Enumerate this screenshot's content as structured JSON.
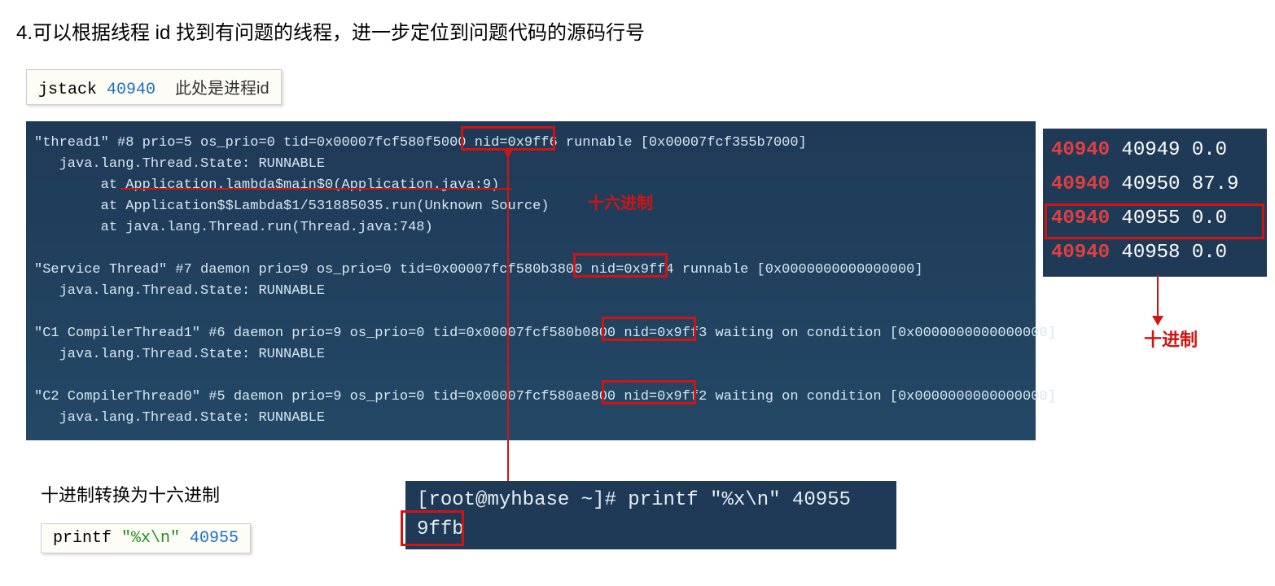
{
  "heading": "4.可以根据线程 id 找到有问题的线程，进一步定位到问题代码的源码行号",
  "box1_cmd": "jstack ",
  "box1_pid": "40940",
  "box1_note": "此处是进程id",
  "term_lines": [
    "\"thread1\" #8 prio=5 os_prio=0 tid=0x00007fcf580f5000 nid=0x9ff6 runnable [0x00007fcf355b7000]",
    "   java.lang.Thread.State: RUNNABLE",
    "        at Application.lambda$main$0(Application.java:9)",
    "        at Application$$Lambda$1/531885035.run(Unknown Source)",
    "        at java.lang.Thread.run(Thread.java:748)",
    "",
    "\"Service Thread\" #7 daemon prio=9 os_prio=0 tid=0x00007fcf580b3800 nid=0x9ff4 runnable [0x0000000000000000]",
    "   java.lang.Thread.State: RUNNABLE",
    "",
    "\"C1 CompilerThread1\" #6 daemon prio=9 os_prio=0 tid=0x00007fcf580b0800 nid=0x9ff3 waiting on condition [0x0000000000000000]",
    "   java.lang.Thread.State: RUNNABLE",
    "",
    "\"C2 CompilerThread0\" #5 daemon prio=9 os_prio=0 tid=0x00007fcf580ae800 nid=0x9ff2 waiting on condition [0x0000000000000000]",
    "   java.lang.Thread.State: RUNNABLE"
  ],
  "annot_hex": "十六进制",
  "side_rows": [
    {
      "pid": "40940",
      "tid": "40949",
      "v": " 0.0"
    },
    {
      "pid": "40940",
      "tid": "40950",
      "v": "87.9"
    },
    {
      "pid": "40940",
      "tid": "40955",
      "v": " 0.0"
    },
    {
      "pid": "40940",
      "tid": "40958",
      "v": " 0.0"
    }
  ],
  "decimal_label": "十进制",
  "bottom_label": "十进制转换为十六进制",
  "printf_cmd_a": "printf ",
  "printf_cmd_b": "\"%x\\n\" ",
  "printf_cmd_c": "40955",
  "bottom_term_line1": "[root@myhbase ~]# printf \"%x\\n\" 40955",
  "bottom_term_line2": "9ffb"
}
